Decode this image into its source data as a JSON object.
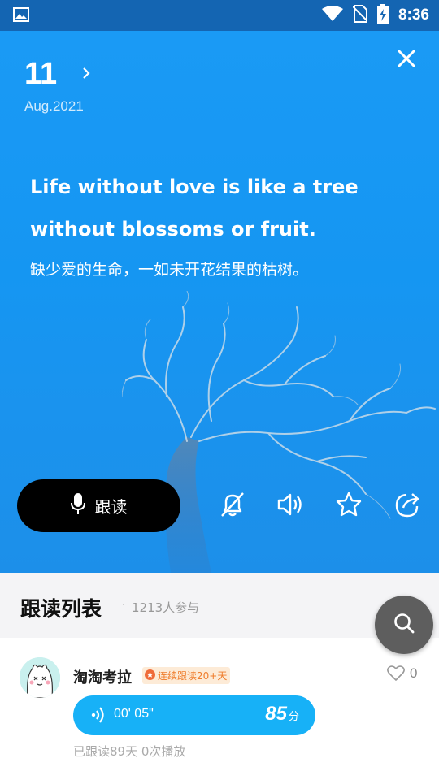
{
  "status_bar": {
    "time": "8:36",
    "icons": [
      "image-icon",
      "wifi-icon",
      "no-sim-icon",
      "battery-charging-icon"
    ]
  },
  "hero": {
    "day": "11",
    "month_year": "Aug.2021",
    "quote_en_line1": "Life without love is like a tree",
    "quote_en_line2": "without blossoms or fruit.",
    "quote_cn": "缺少爱的生命，一如未开花结果的枯树。",
    "follow_read_label": "跟读",
    "actions": [
      "alarm-off-icon",
      "speaker-icon",
      "star-icon",
      "share-icon"
    ],
    "background_color": "#1a97f2"
  },
  "list": {
    "title": "跟读列表",
    "dot": "·",
    "count": "1213人参与",
    "items": [
      {
        "username": "淘淘考拉",
        "badge": "连续跟读20+天",
        "likes": "0",
        "duration": "00' 05\"",
        "score": "85",
        "score_unit": "分",
        "meta": "已跟读89天  0次播放"
      }
    ]
  },
  "colors": {
    "accent": "#17b1f7",
    "badge_text": "#ef7d2c",
    "badge_bg": "#fdebd7",
    "fab": "#5e5e5e"
  }
}
